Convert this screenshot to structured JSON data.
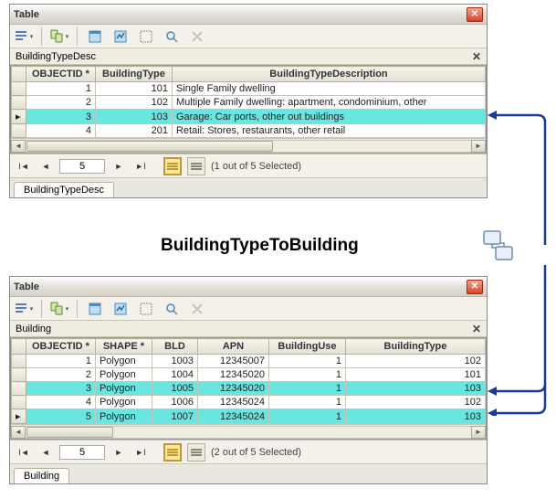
{
  "relation_label": "BuildingTypeToBuilding",
  "panel1": {
    "title": "Table",
    "subtitle": "BuildingTypeDesc",
    "columns": [
      "OBJECTID *",
      "BuildingType",
      "BuildingTypeDescription"
    ],
    "rows": [
      {
        "id": "1",
        "type": "101",
        "desc": "Single Family dwelling",
        "sel": false,
        "cursor": false
      },
      {
        "id": "2",
        "type": "102",
        "desc": "Multiple Family dwelling: apartment, condominium, other",
        "sel": false,
        "cursor": false
      },
      {
        "id": "3",
        "type": "103",
        "desc": "Garage: Car ports, other out buildings",
        "sel": true,
        "cursor": true
      },
      {
        "id": "4",
        "type": "201",
        "desc": "Retail: Stores, restaurants, other retail",
        "sel": false,
        "cursor": false
      }
    ],
    "nav_total": "5",
    "sel_text": "(1 out of 5 Selected)",
    "tab": "BuildingTypeDesc"
  },
  "panel2": {
    "title": "Table",
    "subtitle": "Building",
    "columns": [
      "OBJECTID *",
      "SHAPE *",
      "BLD",
      "APN",
      "BuildingUse",
      "BuildingType"
    ],
    "rows": [
      {
        "id": "1",
        "shape": "Polygon",
        "bld": "1003",
        "apn": "12345007",
        "use": "1",
        "type": "102",
        "sel": false,
        "cursor": false
      },
      {
        "id": "2",
        "shape": "Polygon",
        "bld": "1004",
        "apn": "12345020",
        "use": "1",
        "type": "101",
        "sel": false,
        "cursor": false
      },
      {
        "id": "3",
        "shape": "Polygon",
        "bld": "1005",
        "apn": "12345020",
        "use": "1",
        "type": "103",
        "sel": true,
        "cursor": false
      },
      {
        "id": "4",
        "shape": "Polygon",
        "bld": "1006",
        "apn": "12345024",
        "use": "1",
        "type": "102",
        "sel": false,
        "cursor": false
      },
      {
        "id": "5",
        "shape": "Polygon",
        "bld": "1007",
        "apn": "12345024",
        "use": "1",
        "type": "103",
        "sel": true,
        "cursor": true
      }
    ],
    "nav_total": "5",
    "sel_text": "(2 out of 5 Selected)",
    "tab": "Building"
  }
}
